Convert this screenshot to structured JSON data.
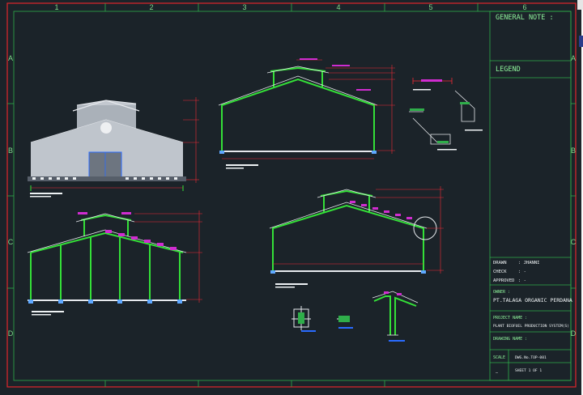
{
  "colors": {
    "background": "#1b2329",
    "outer_border": "#e0262b",
    "grid_lines": "#2fae4a",
    "structure": "#34e038",
    "dimension": "#f22a36",
    "text_green": "#8ff59c",
    "text_white": "#eef2f4",
    "building_wall": "#bfc5cc",
    "accent_magenta": "#d02cd0",
    "accent_blue": "#2a6bff"
  },
  "border": {
    "column_labels": [
      "1",
      "2",
      "3",
      "4",
      "5",
      "6"
    ],
    "row_labels": [
      "A",
      "B",
      "C",
      "D"
    ]
  },
  "title_block": {
    "general_note_label": "GENERAL NOTE :",
    "legend_label": "LEGEND",
    "drawn_label": "DRAWN",
    "drawn_value": ": JHANNI",
    "check_label": "CHECK",
    "check_value": ": -",
    "approved_label": "APPROVED",
    "approved_value": ": -",
    "owner_label": "OWNER :",
    "owner_value": "PT.TALAGA ORGANIC PERDANA",
    "project_label": "PROJECT NAME :",
    "project_value": "PLANT BIOFUEL PRODUCTION SYSTEM(S)",
    "drawing_label": "DRAWING NAME :",
    "scale_label": "SCALE",
    "scale_value": "DWG.No.TOP-001",
    "sheet_label": "SHEET 1 OF 1",
    "footer_mark": "—"
  }
}
